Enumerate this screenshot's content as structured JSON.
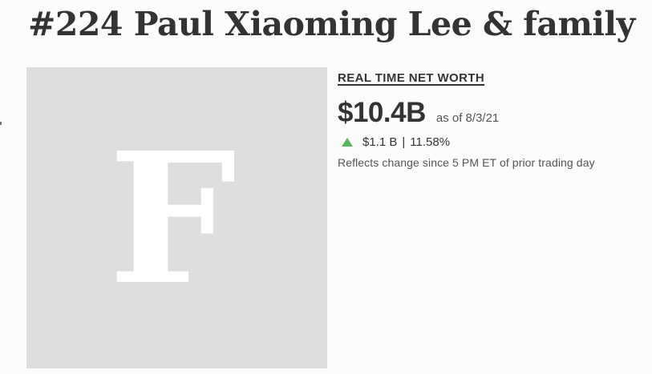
{
  "profile": {
    "rank_name": "#224 Paul Xiaoming Lee & family",
    "image_letter": "F"
  },
  "net_worth": {
    "label": "REAL TIME NET WORTH",
    "value": "$10.4B",
    "as_of": "as of 8/3/21",
    "change_amount": "$1.1 B",
    "change_separator": "|",
    "change_percent": "11.58%",
    "direction": "up",
    "note": "Reflects change since 5 PM ET of prior trading day"
  },
  "colors": {
    "up_green": "#53b95e",
    "placeholder_gray": "#dedede",
    "text_dark": "#333333"
  }
}
